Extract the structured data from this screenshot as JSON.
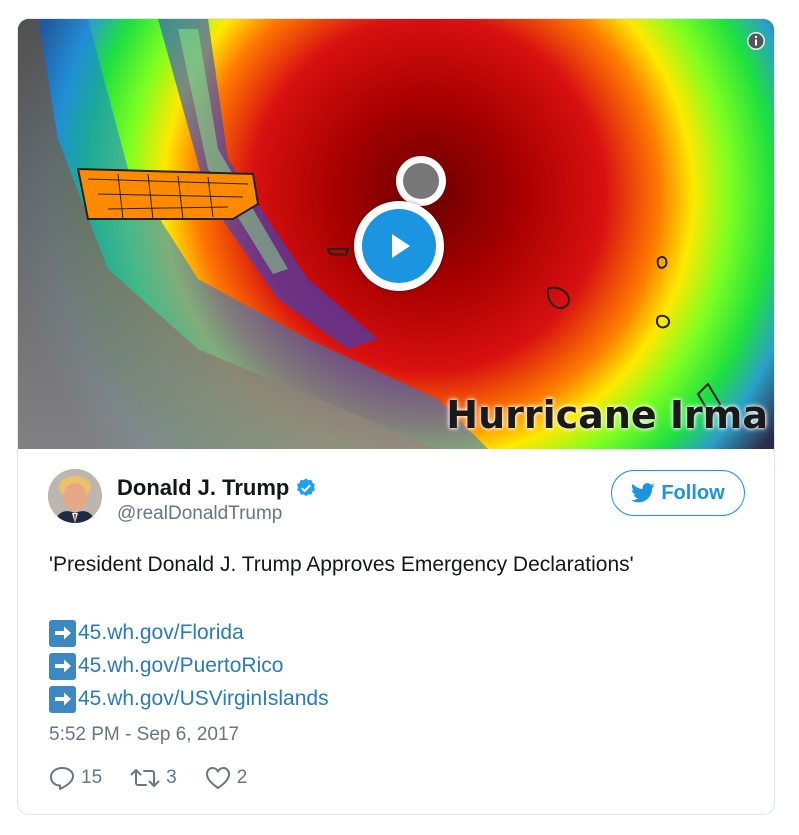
{
  "media": {
    "video_title": "Hurricane Irma",
    "info_icon": "info-icon",
    "play_icon": "play-icon"
  },
  "author": {
    "name": "Donald J. Trump",
    "handle": "@realDonaldTrump",
    "verified_icon": "verified-badge-icon",
    "avatar": "avatar"
  },
  "follow": {
    "label": "Follow",
    "icon": "twitter-bird-icon"
  },
  "tweet": {
    "text": "'President Donald J. Trump Approves Emergency Declarations'",
    "links": [
      {
        "icon": "right-arrow-icon",
        "text": "45.wh.gov/Florida"
      },
      {
        "icon": "right-arrow-icon",
        "text": "45.wh.gov/PuertoRico"
      },
      {
        "icon": "right-arrow-icon",
        "text": "45.wh.gov/USVirginIslands"
      }
    ],
    "timestamp": "5:52 PM - Sep 6, 2017"
  },
  "actions": {
    "reply_count": "15",
    "retweet_count": "3",
    "like_count": "2"
  },
  "colors": {
    "accent": "#1b95e0",
    "link": "#2b7bb9",
    "muted": "#657786",
    "text": "#14171a"
  }
}
